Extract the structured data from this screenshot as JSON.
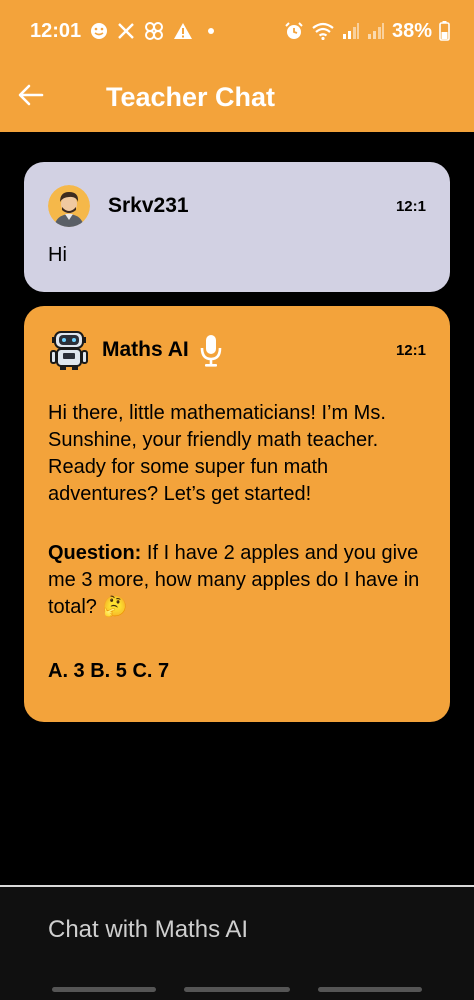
{
  "status_bar": {
    "time": "12:01",
    "battery": "38%",
    "left_icons": [
      "smiley-icon",
      "x-icon",
      "pinwheel-icon",
      "warning-icon",
      "dot-icon"
    ],
    "right_icons": [
      "alarm-icon",
      "wifi-icon",
      "signal-icon",
      "signal-icon",
      "battery-icon"
    ]
  },
  "header": {
    "back_icon": "arrow-left-icon",
    "title": "Teacher Chat"
  },
  "messages": [
    {
      "sender": "Srkv231",
      "time": "12:1",
      "text": "Hi",
      "avatar": "user-avatar"
    },
    {
      "sender": "Maths AI",
      "time": "12:1",
      "avatar": "robot-icon",
      "mic_icon": "microphone-icon",
      "intro": "Hi there, little mathematicians!  I’m Ms.  Sunshine, your friendly math teacher.  Ready for some super fun math adventures?  Let’s get started!",
      "question_label": "Question:",
      "question_text": "  If I have 2 apples and you give me 3 more, how many apples do I have in total? 🤔",
      "options": "A. 3  B. 5  C. 7"
    }
  ],
  "input": {
    "placeholder": "Chat with Maths AI"
  },
  "colors": {
    "accent": "#F3A33B",
    "user_bubble": "#D2D1E3",
    "background": "#000000"
  }
}
